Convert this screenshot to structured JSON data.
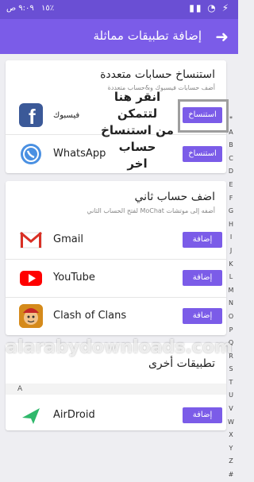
{
  "status": {
    "time": "٩:٠٩ ص",
    "battery": "١٥٪",
    "icons": "▮▮ ◔ ⚡"
  },
  "appbar": {
    "title": "إضافة تطبيقات مماثلة",
    "back_icon": "arrow-back-icon"
  },
  "clone_card": {
    "title": "استنساخ حسابات متعددة",
    "subtitle": "أضف حسابات فيسبوك و&حساب متعددة",
    "apps": [
      {
        "name": "فيسبوك",
        "button": "استنساخ",
        "icon": "facebook-icon"
      },
      {
        "name": "WhatsApp",
        "button": "استنساخ",
        "icon": "whatsapp-icon"
      }
    ]
  },
  "annotation": {
    "lines": [
      "انقر هنا لتتمكن",
      "من استنساخ حساب",
      "اخر"
    ]
  },
  "second_card": {
    "title": "اضف حساب ثاني",
    "subtitle": "أضفه إلى موتشات MoChat لفتح الحساب الثاني",
    "apps": [
      {
        "name": "Gmail",
        "button": "إضافة",
        "icon": "gmail-icon"
      },
      {
        "name": "YouTube",
        "button": "إضافة",
        "icon": "youtube-icon"
      },
      {
        "name": "Clash of Clans",
        "button": "إضافة",
        "icon": "clash-of-clans-icon"
      }
    ]
  },
  "other_card": {
    "title": "تطبيقات أخرى",
    "section_letter": "A",
    "apps": [
      {
        "name": "AirDroid",
        "button": "إضافة",
        "icon": "airdroid-icon"
      }
    ]
  },
  "alphabet": [
    "*",
    "A",
    "B",
    "C",
    "D",
    "E",
    "F",
    "G",
    "H",
    "I",
    "J",
    "K",
    "L",
    "M",
    "N",
    "O",
    "P",
    "Q",
    "R",
    "S",
    "T",
    "U",
    "V",
    "W",
    "X",
    "Y",
    "Z",
    "#"
  ],
  "watermark": "alarabydownloads.com",
  "colors": {
    "accent": "#7b5ce8",
    "statusbar": "#6a4fd4"
  }
}
